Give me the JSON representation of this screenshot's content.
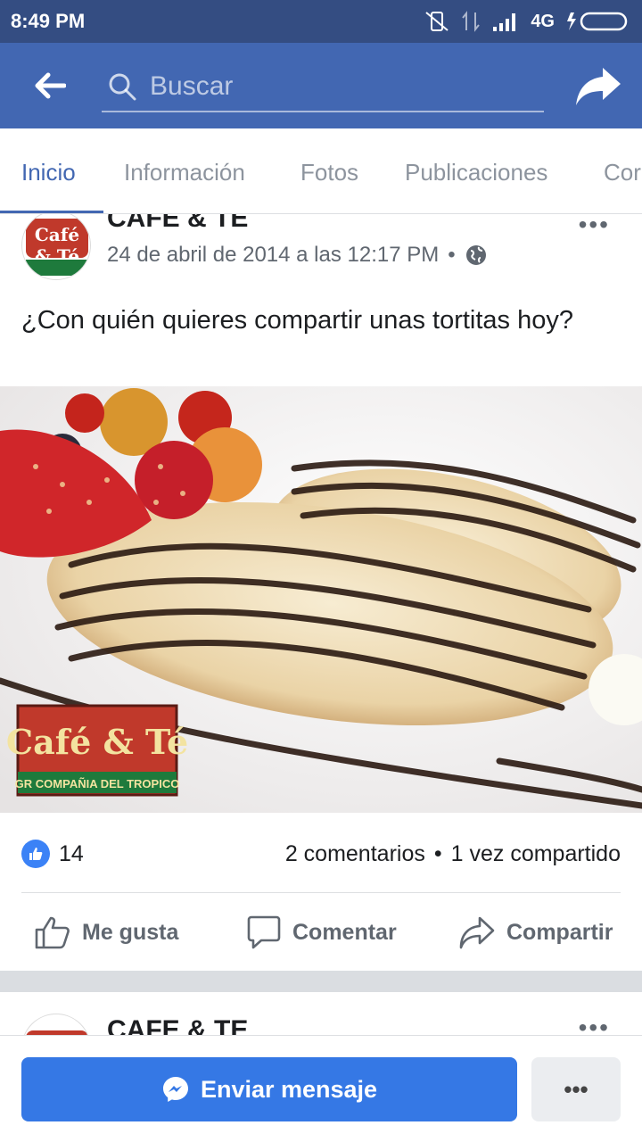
{
  "status_bar": {
    "time": "8:49 PM",
    "network": "4G"
  },
  "header": {
    "search_placeholder": "Buscar"
  },
  "tabs": [
    {
      "label": "Inicio",
      "active": true
    },
    {
      "label": "Información"
    },
    {
      "label": "Fotos"
    },
    {
      "label": "Publicaciones"
    },
    {
      "label": "Cor"
    }
  ],
  "post": {
    "page_name": "CAFE & TE",
    "timestamp": "24 de abril de 2014 a las 12:17 PM",
    "separator": "•",
    "text": "¿Con quién quieres compartir unas tortitas hoy?",
    "avatar_logo_text": "Café & Té",
    "photo_logo_title": "Café & Té",
    "photo_logo_subtitle": "GR COMPAÑIA DEL TROPICO",
    "likes": "14",
    "comments": "2 comentarios",
    "shares": "1 vez compartido",
    "actions": {
      "like": "Me gusta",
      "comment": "Comentar",
      "share": "Compartir"
    }
  },
  "next_post": {
    "page_name": "CAFE & TE"
  },
  "bottom_bar": {
    "send_message": "Enviar mensaje",
    "more": "•••"
  },
  "colors": {
    "brand_blue": "#4267b2",
    "status_bar": "#344d82",
    "messenger_blue": "#3578e5"
  },
  "icons": [
    "back-arrow-icon",
    "search-icon",
    "share-arrow-icon",
    "globe-icon",
    "like-thumb-icon",
    "comment-bubble-icon",
    "share-icon",
    "messenger-icon",
    "more-icon"
  ]
}
